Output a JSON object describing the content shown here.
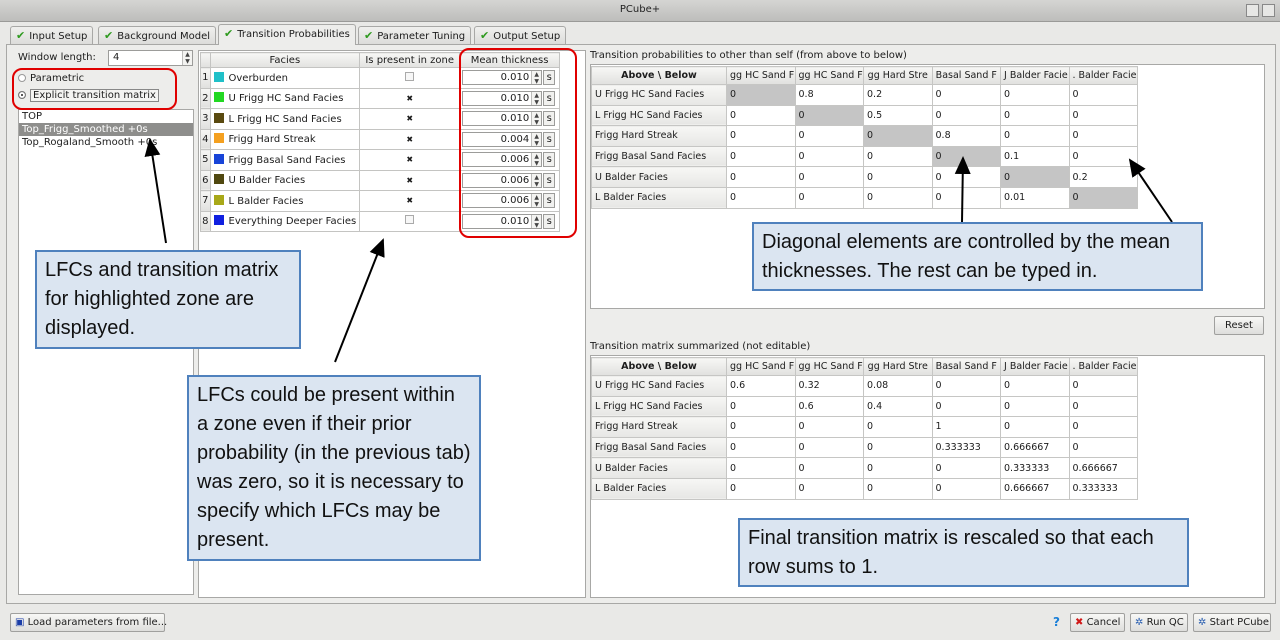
{
  "window": {
    "title": "PCube+"
  },
  "tabs": [
    {
      "label": "Input Setup",
      "active": false
    },
    {
      "label": "Background Model",
      "active": false
    },
    {
      "label": "Transition Probabilities",
      "active": true
    },
    {
      "label": "Parameter Tuning",
      "active": false
    },
    {
      "label": "Output Setup",
      "active": false
    }
  ],
  "left": {
    "window_length_label": "Window length:",
    "window_length_value": "4",
    "mode_parametric": "Parametric",
    "mode_explicit": "Explicit transition matrix",
    "zones": [
      "TOP",
      "Top_Frigg_Smoothed +0s",
      "Top_Rogaland_Smooth +0s"
    ],
    "selected_zone": "Top_Frigg_Smoothed +0s"
  },
  "facies_table": {
    "headers": [
      "Facies",
      "Is present in zone",
      "Mean thickness"
    ],
    "rows": [
      {
        "n": "1",
        "name": "Overburden",
        "color": "#20c0c8",
        "present": false,
        "thickness": "0.010"
      },
      {
        "n": "2",
        "name": "U Frigg HC Sand Facies",
        "color": "#22d822",
        "present": true,
        "thickness": "0.010"
      },
      {
        "n": "3",
        "name": "L Frigg HC Sand Facies",
        "color": "#5a4a10",
        "present": true,
        "thickness": "0.010"
      },
      {
        "n": "4",
        "name": "Frigg Hard Streak",
        "color": "#f4a020",
        "present": true,
        "thickness": "0.004"
      },
      {
        "n": "5",
        "name": "Frigg Basal Sand Facies",
        "color": "#1844d8",
        "present": true,
        "thickness": "0.006"
      },
      {
        "n": "6",
        "name": "U Balder Facies",
        "color": "#504810",
        "present": true,
        "thickness": "0.006"
      },
      {
        "n": "7",
        "name": "L Balder Facies",
        "color": "#a8a818",
        "present": true,
        "thickness": "0.006"
      },
      {
        "n": "8",
        "name": "Everything Deeper Facies",
        "color": "#1020e0",
        "present": false,
        "thickness": "0.010"
      }
    ],
    "spin_unit": "s"
  },
  "transition_top": {
    "title": "Transition probabilities to other than self (from above to below)",
    "corner": "Above \\ Below",
    "cols": [
      "gg HC Sand F",
      "gg HC Sand F",
      "gg Hard Stre",
      "Basal Sand F",
      "J Balder Facie",
      ". Balder Facie"
    ],
    "rows": [
      {
        "label": "U Frigg HC Sand Facies",
        "values": [
          "0",
          "0.8",
          "0.2",
          "0",
          "0",
          "0"
        ]
      },
      {
        "label": "L Frigg HC Sand Facies",
        "values": [
          "0",
          "0",
          "0.5",
          "0",
          "0",
          "0"
        ]
      },
      {
        "label": "Frigg Hard Streak",
        "values": [
          "0",
          "0",
          "0",
          "0.8",
          "0",
          "0"
        ]
      },
      {
        "label": "Frigg Basal Sand Facies",
        "values": [
          "0",
          "0",
          "0",
          "0",
          "0.1",
          "0"
        ]
      },
      {
        "label": "U Balder Facies",
        "values": [
          "0",
          "0",
          "0",
          "0",
          "0",
          "0.2"
        ]
      },
      {
        "label": "L Balder Facies",
        "values": [
          "0",
          "0",
          "0",
          "0",
          "0.01",
          "0"
        ]
      }
    ]
  },
  "transition_bottom": {
    "title": "Transition matrix summarized (not editable)",
    "corner": "Above \\ Below",
    "cols": [
      "gg HC Sand F",
      "gg HC Sand F",
      "gg Hard Stre",
      "Basal Sand F",
      "J Balder Facie",
      ". Balder Facie"
    ],
    "rows": [
      {
        "label": "U Frigg HC Sand Facies",
        "values": [
          "0.6",
          "0.32",
          "0.08",
          "0",
          "0",
          "0"
        ]
      },
      {
        "label": "L Frigg HC Sand Facies",
        "values": [
          "0",
          "0.6",
          "0.4",
          "0",
          "0",
          "0"
        ]
      },
      {
        "label": "Frigg Hard Streak",
        "values": [
          "0",
          "0",
          "0",
          "1",
          "0",
          "0"
        ]
      },
      {
        "label": "Frigg Basal Sand Facies",
        "values": [
          "0",
          "0",
          "0",
          "0.333333",
          "0.666667",
          "0"
        ]
      },
      {
        "label": "U Balder Facies",
        "values": [
          "0",
          "0",
          "0",
          "0",
          "0.333333",
          "0.666667"
        ]
      },
      {
        "label": "L Balder Facies",
        "values": [
          "0",
          "0",
          "0",
          "0",
          "0.666667",
          "0.333333"
        ]
      }
    ]
  },
  "buttons": {
    "reset": "Reset",
    "load": "Load parameters from file...",
    "help": "?",
    "cancel": "Cancel",
    "run_qc": "Run QC",
    "start": "Start PCube"
  },
  "annotations": {
    "lfc_note": "LFCs and transition matrix for highlighted zone are displayed.",
    "present_note": "LFCs could be present within a zone even if their prior probability (in the previous tab) was zero, so it is necessary to specify which LFCs may be present.",
    "diagonal_note": "Diagonal elements are controlled by the mean thicknesses. The rest can be typed in.",
    "final_note": "Final transition matrix is rescaled so that each row sums to 1."
  },
  "colors": {
    "annotation_fill": "#dbe5f1",
    "annotation_border": "#4f81bd",
    "highlight_red": "#e00000",
    "diagonal_gray": "#c5c5c5"
  }
}
